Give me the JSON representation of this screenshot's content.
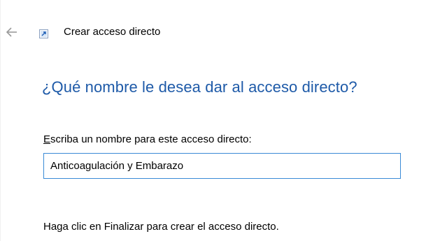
{
  "window": {
    "title": "Crear acceso directo",
    "back_icon": "arrow-left-icon",
    "app_icon": "shortcut-icon"
  },
  "main": {
    "heading": "¿Qué nombre le desea dar al acceso directo?",
    "field_label_first_letter": "E",
    "field_label_rest": "scriba un nombre para este acceso directo:",
    "name_value": "Anticoagulación y Embarazo",
    "footer_text": "Haga clic en Finalizar para crear el acceso directo."
  },
  "colors": {
    "heading": "#1e5aa8",
    "input_border": "#3a8ad6"
  }
}
